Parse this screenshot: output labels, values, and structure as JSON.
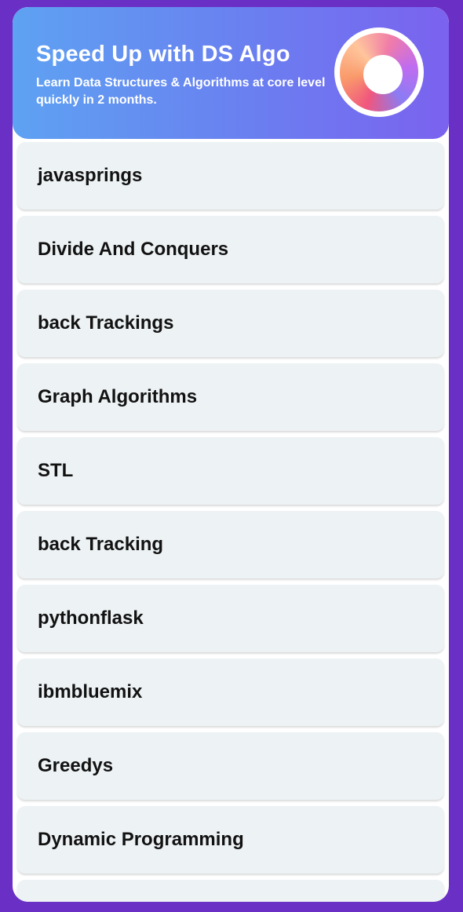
{
  "header": {
    "title": "Speed Up with DS Algo",
    "subtitle": "Learn Data Structures & Algorithms at core level quickly in 2 months."
  },
  "topics": [
    "javasprings",
    "Divide And Conquers",
    "back Trackings",
    "Graph Algorithms",
    "STL",
    "back Tracking",
    "pythonflask",
    "ibmbluemix",
    "Greedys",
    "Dynamic Programming",
    ""
  ],
  "colors": {
    "frame": "#6a2fc4",
    "header_gradient_start": "#5ea2f2",
    "header_gradient_end": "#7b62ef",
    "card_background": "#edf2f4"
  },
  "icons": {
    "logo": "gradient-ring-logo-icon"
  }
}
